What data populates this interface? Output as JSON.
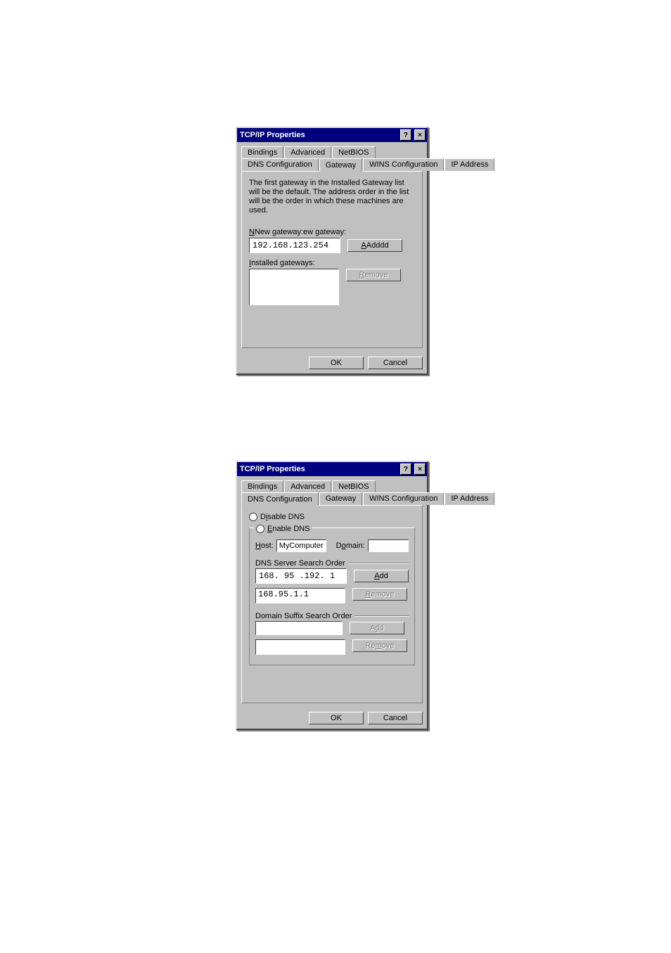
{
  "dialog1": {
    "title": "TCP/IP Properties",
    "tabs_row1": [
      "Bindings",
      "Advanced",
      "NetBIOS"
    ],
    "tabs_row2": [
      "DNS Configuration",
      "Gateway",
      "WINS Configuration",
      "IP Address"
    ],
    "active_tab": "Gateway",
    "description": "The first gateway in the Installed Gateway list will be the default. The address order in the list will be the order in which these machines are used.",
    "new_gateway_label": "New gateway:",
    "new_gateway_value": "192.168.123.254",
    "add_label": "Add",
    "installed_label": "Installed gateways:",
    "remove_label": "Remove",
    "ok_label": "OK",
    "cancel_label": "Cancel"
  },
  "dialog2": {
    "title": "TCP/IP Properties",
    "tabs_row1": [
      "Bindings",
      "Advanced",
      "NetBIOS"
    ],
    "tabs_row2": [
      "DNS Configuration",
      "Gateway",
      "WINS Configuration",
      "IP Address"
    ],
    "active_tab": "DNS Configuration",
    "disable_label": "Disable DNS",
    "enable_label": "Enable DNS",
    "enable_selected": true,
    "host_label": "Host:",
    "host_value": "MyComputer",
    "domain_label": "Domain:",
    "domain_value": "",
    "dns_search_label": "DNS Server Search Order",
    "dns_input_value": "168. 95 .192.  1",
    "dns_list_value": "168.95.1.1",
    "add_label": "Add",
    "remove_label": "Remove",
    "suffix_label": "Domain Suffix Search Order",
    "suffix_add_label": "Add",
    "suffix_remove_label": "Remove",
    "ok_label": "OK",
    "cancel_label": "Cancel"
  }
}
